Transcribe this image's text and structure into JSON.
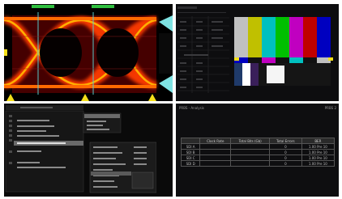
{
  "prbs": {
    "title": "PRBS - Analysis",
    "corner": "PRBS 2",
    "headers": [
      "",
      "Clock Rate",
      "Total Bits (Gb)",
      "Total Errors",
      "BER"
    ],
    "rows": [
      [
        "SDI A",
        "",
        "",
        "0",
        "1.00 Pre 10"
      ],
      [
        "SDI B",
        "",
        "",
        "0",
        "1.00 Pre 10"
      ],
      [
        "SDI C",
        "",
        "",
        "0",
        "1.00 Pre 10"
      ],
      [
        "SDI D",
        "",
        "",
        "0",
        "1.00 Pre 10"
      ]
    ]
  },
  "colors": {
    "eye_hot": "#ffb000",
    "eye_core": "#ff2a00",
    "eye_bg": "#8a0000",
    "marker_cyan": "#7fe3e3",
    "marker_yellow": "#f4e01a",
    "top_bar_green": "#2fbf3f",
    "bars": [
      "#c0c0c0",
      "#c0c000",
      "#00c0c0",
      "#00c000",
      "#c000c0",
      "#c00000",
      "#0000c0"
    ]
  }
}
